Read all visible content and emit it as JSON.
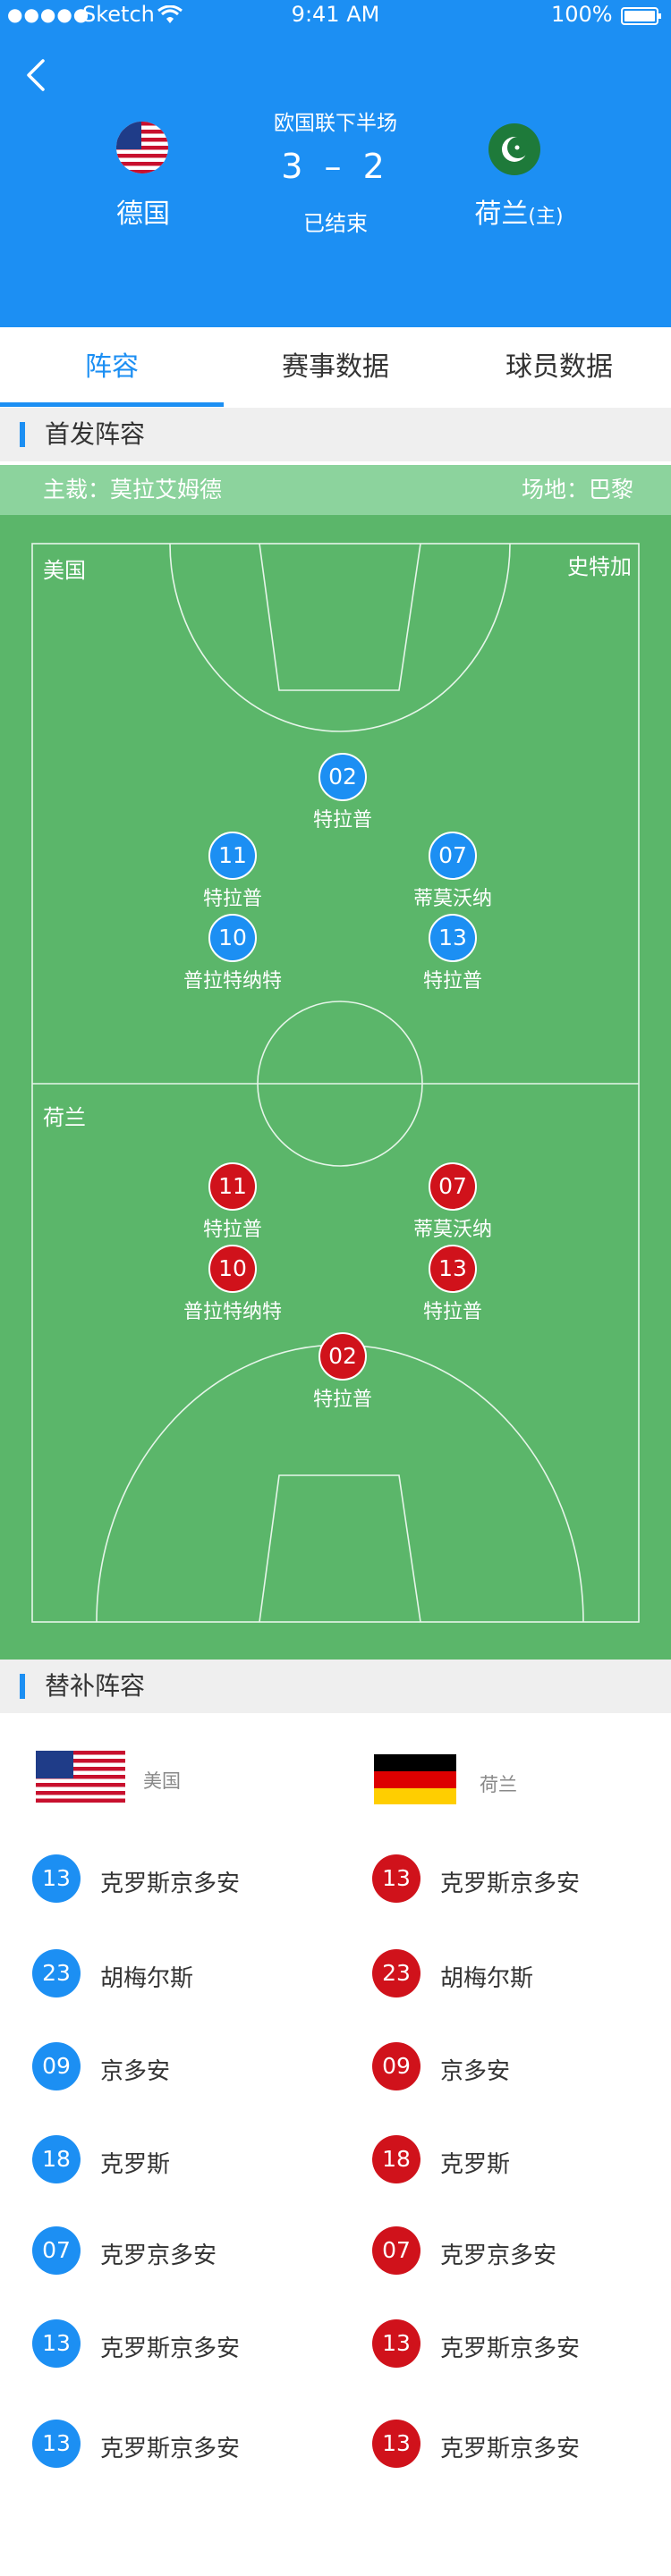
{
  "status_bar": {
    "signal": "●●●●●",
    "carrier": "Sketch",
    "time": "9:41 AM",
    "battery": "100%"
  },
  "match": {
    "league": "欧国联下半场",
    "score": "3 – 2",
    "status": "已结束",
    "home_team": "德国",
    "away_team": "荷兰",
    "away_tag": "(主)"
  },
  "tabs": [
    "阵容",
    "赛事数据",
    "球员数据"
  ],
  "starting": {
    "title": "首发阵容",
    "coach": "主裁：莫拉艾姆德",
    "venue": "场地：巴黎",
    "top_team_label": "美国",
    "top_team_right_label": "史特加",
    "bottom_team_label": "荷兰",
    "home_players": [
      {
        "num": "02",
        "name": "特拉普"
      },
      {
        "num": "11",
        "name": "特拉普"
      },
      {
        "num": "07",
        "name": "蒂莫沃纳"
      },
      {
        "num": "10",
        "name": "普拉特纳特"
      },
      {
        "num": "13",
        "name": "特拉普"
      }
    ],
    "away_players": [
      {
        "num": "11",
        "name": "特拉普"
      },
      {
        "num": "07",
        "name": "蒂莫沃纳"
      },
      {
        "num": "10",
        "name": "普拉特纳特"
      },
      {
        "num": "13",
        "name": "特拉普"
      },
      {
        "num": "02",
        "name": "特拉普"
      }
    ]
  },
  "subs": {
    "title": "替补阵容",
    "left_team": "美国",
    "right_team": "荷兰",
    "left": [
      {
        "num": "13",
        "name": "克罗斯京多安"
      },
      {
        "num": "23",
        "name": "胡梅尔斯"
      },
      {
        "num": "09",
        "name": "京多安"
      },
      {
        "num": "18",
        "name": "克罗斯"
      },
      {
        "num": "07",
        "name": "克罗京多安"
      },
      {
        "num": "13",
        "name": "克罗斯京多安"
      },
      {
        "num": "13",
        "name": "克罗斯京多安"
      }
    ],
    "right": [
      {
        "num": "13",
        "name": "克罗斯京多安"
      },
      {
        "num": "23",
        "name": "胡梅尔斯"
      },
      {
        "num": "09",
        "name": "京多安"
      },
      {
        "num": "18",
        "name": "克罗斯"
      },
      {
        "num": "07",
        "name": "克罗京多安"
      },
      {
        "num": "13",
        "name": "克罗斯京多安"
      },
      {
        "num": "13",
        "name": "克罗斯京多安"
      }
    ]
  },
  "colors": {
    "primary": "#1c8ff3",
    "home": "#1c8ff3",
    "away": "#d0121b",
    "pitch": "#5bb66a",
    "coach_bar": "#8cd39d"
  }
}
